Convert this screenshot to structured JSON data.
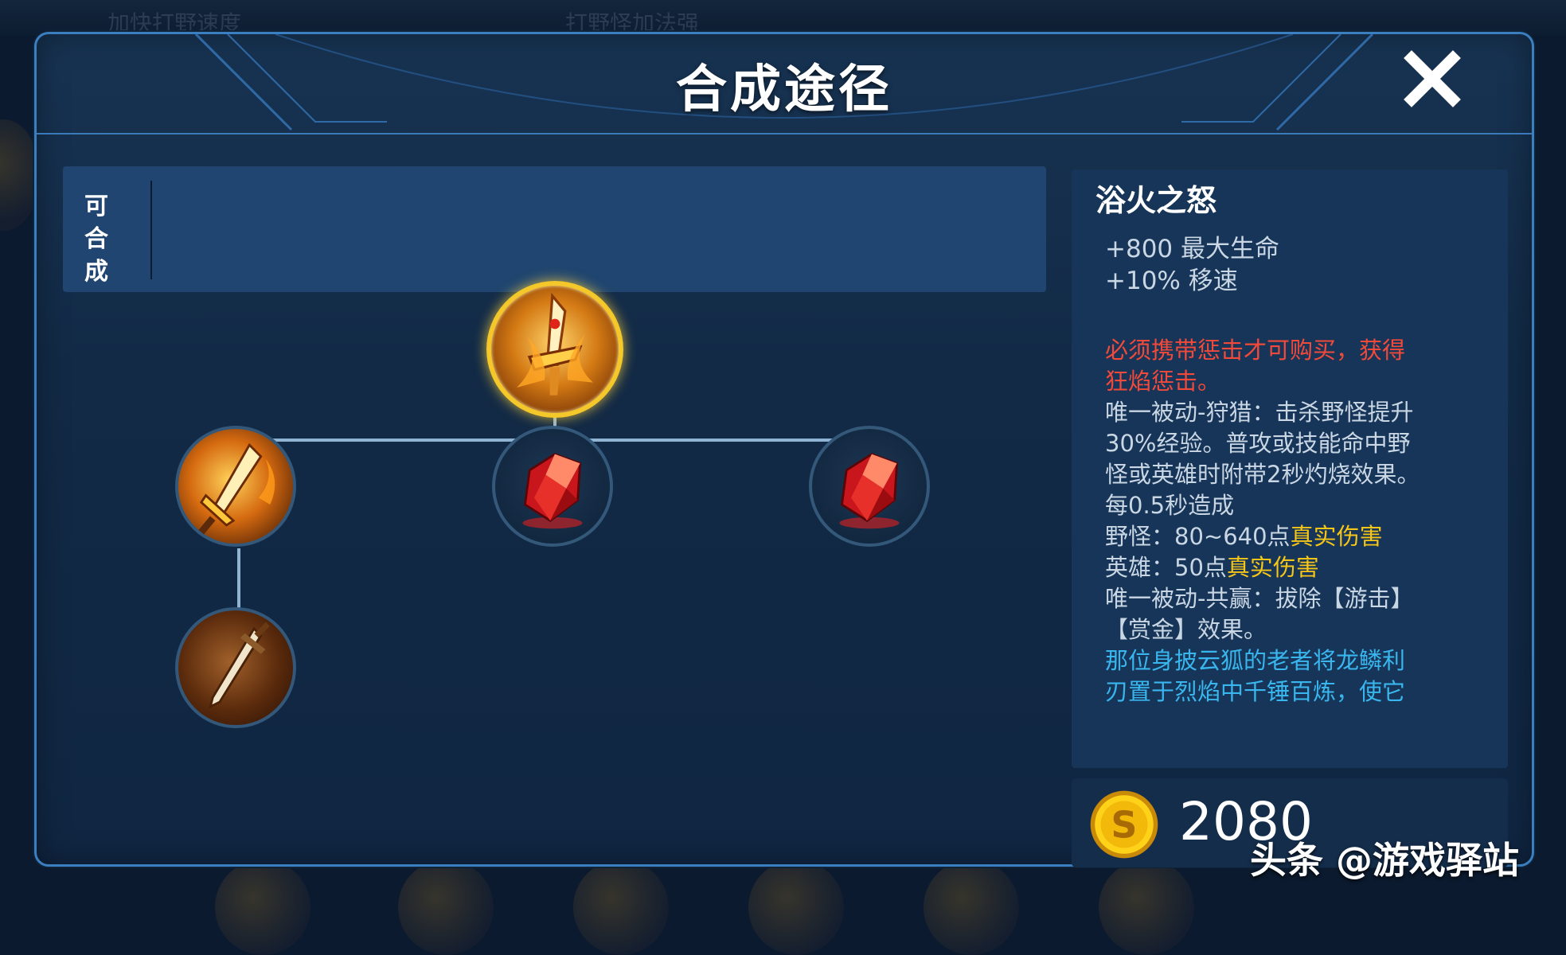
{
  "background": {
    "ghost_text_left": "加快打野速度",
    "ghost_text_right": "打野怪加法强"
  },
  "dialog": {
    "title": "合成途径",
    "close_icon": "close-x-icon"
  },
  "craft_panel": {
    "label": "可合成"
  },
  "tree": {
    "root": {
      "icon": "flaming-blade-icon"
    },
    "children": [
      {
        "icon": "golden-blade-icon"
      },
      {
        "icon": "red-gem-icon"
      },
      {
        "icon": "red-gem-icon"
      }
    ],
    "grandchild": {
      "icon": "dagger-icon"
    }
  },
  "item": {
    "name": "浴火之怒",
    "stats": [
      "+800 最大生命",
      "+10% 移速"
    ],
    "requirement_line1": "必须携带惩击才可购买，获得",
    "requirement_line2": "狂焰惩击。",
    "passive1_line1": "唯一被动-狩猎：击杀野怪提升",
    "passive1_line2": "30%经验。普攻或技能命中野",
    "passive1_line3": "怪或英雄时附带2秒灼烧效果。",
    "passive1_line4": "每0.5秒造成",
    "monster_prefix": "野怪：80~640点",
    "monster_dmg": "真实伤害",
    "hero_prefix": "英雄：50点",
    "hero_dmg": "真实伤害",
    "passive2_line1": "唯一被动-共赢：拔除【游击】",
    "passive2_line2": "【赏金】效果。",
    "lore_line1": "那位身披云狐的老者将龙鳞利",
    "lore_line2": "刃置于烈焰中千锤百炼，使它"
  },
  "price": {
    "icon": "gold-coin-icon",
    "value": "2080"
  },
  "watermark": "头条 @游戏驿站",
  "colors": {
    "requirement": "#f24a3a",
    "true_damage": "#f5c518",
    "lore": "#39b6ee",
    "border": "#3b7fc0"
  }
}
